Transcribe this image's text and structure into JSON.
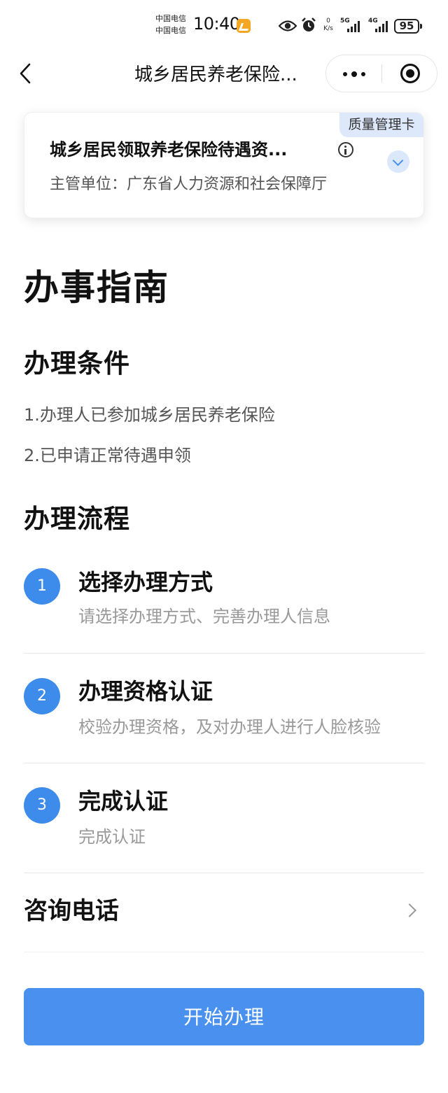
{
  "status_bar": {
    "carrier_1": "中国电信",
    "carrier_2": "中国电信",
    "time": "10:40",
    "net_speed_value": "0",
    "net_speed_unit": "K/s",
    "signal_1_label": "5G",
    "signal_2_label": "4G",
    "battery": "95"
  },
  "nav": {
    "title": "城乡居民养老保险..."
  },
  "service_card": {
    "tag": "质量管理卡",
    "name": "城乡居民领取养老保险待遇资...",
    "department": "主管单位：广东省人力资源和社会保障厅"
  },
  "guide": {
    "title": "办事指南",
    "conditions_title": "办理条件",
    "conditions": [
      "1.办理人已参加城乡居民养老保险",
      "2.已申请正常待遇申领"
    ],
    "process_title": "办理流程",
    "steps": [
      {
        "num": "1",
        "title": "选择办理方式",
        "desc": "请选择办理方式、完善办理人信息"
      },
      {
        "num": "2",
        "title": "办理资格认证",
        "desc": "校验办理资格，及对办理人进行人脸核验"
      },
      {
        "num": "3",
        "title": "完成认证",
        "desc": "完成认证"
      }
    ],
    "contact_label": "咨询电话"
  },
  "actions": {
    "start_label": "开始办理"
  },
  "colors": {
    "accent": "#4a90ee",
    "step_circle": "#3d8bea",
    "tag_bg": "#dde9fb"
  },
  "icons": [
    "back-arrow-icon",
    "more-dots-icon",
    "close-target-icon",
    "info-icon",
    "chevron-down-icon",
    "chevron-right-icon",
    "eye-icon",
    "alarm-icon"
  ]
}
